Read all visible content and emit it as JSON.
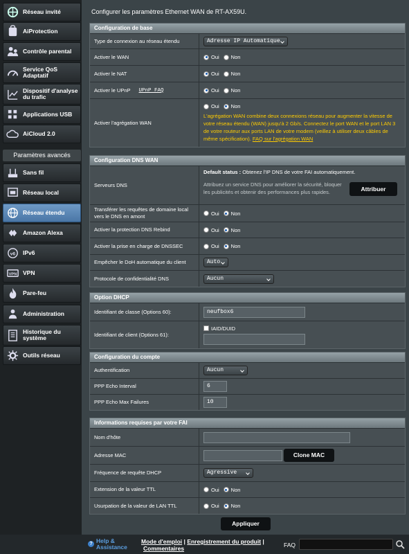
{
  "sidebar": {
    "top_items": [
      {
        "label": "Réseau invité",
        "icon": "guest-network-icon"
      },
      {
        "label": "AiProtection",
        "icon": "aiprotection-icon"
      },
      {
        "label": "Contrôle parental",
        "icon": "parental-control-icon"
      },
      {
        "label": "Service QoS Adaptatif",
        "icon": "qos-icon"
      },
      {
        "label": "Dispositif d'analyse du trafic",
        "icon": "traffic-analyzer-icon"
      },
      {
        "label": "Applications USB",
        "icon": "usb-icon"
      },
      {
        "label": "AiCloud 2.0",
        "icon": "cloud-icon"
      }
    ],
    "advanced_header": "Paramètres avancés",
    "adv_items": [
      {
        "label": "Sans fil",
        "icon": "wireless-icon"
      },
      {
        "label": "Réseau local",
        "icon": "lan-icon"
      },
      {
        "label": "Réseau étendu",
        "icon": "wan-icon"
      },
      {
        "label": "Amazon Alexa",
        "icon": "alexa-icon"
      },
      {
        "label": "IPv6",
        "icon": "ipv6-icon"
      },
      {
        "label": "VPN",
        "icon": "vpn-icon"
      },
      {
        "label": "Pare-feu",
        "icon": "firewall-icon"
      },
      {
        "label": "Administration",
        "icon": "admin-icon"
      },
      {
        "label": "Historique du système",
        "icon": "log-icon"
      },
      {
        "label": "Outils réseau",
        "icon": "tools-icon"
      }
    ]
  },
  "intro": "Configurer les paramètres Ethernet WAN de RT-AX59U.",
  "common": {
    "yes": "Oui",
    "no": "Non"
  },
  "basic": {
    "title": "Configuration de base",
    "conn_type_label": "Type de connexion au réseau étendu",
    "conn_type_value": "Adresse IP Automatique",
    "enable_wan": "Activer le WAN",
    "enable_nat": "Activer le NAT",
    "enable_upnp": "Activer le UPnP",
    "upnp_faq": "UPnP FAQ",
    "wan_agg": "Activer l'agrégation WAN",
    "wan_agg_desc": "L'agrégation WAN combine deux connexions réseau pour augmenter la vitesse de votre réseau étendu (WAN) jusqu'à 2 Gb/s. Connectez le port WAN et le port LAN 3 de votre routeur aux ports LAN de votre modem (veillez à utiliser deux câbles de même spécification).",
    "wan_agg_faq": "FAQ sur l'agrégation WAN"
  },
  "dns": {
    "title": "Configuration DNS WAN",
    "servers_label": "Serveurs DNS",
    "default_status": "Default status :",
    "default_status_text": "Obtenez l'IP DNS de votre FAI automatiquement.",
    "assign_desc": "Attribuez un service DNS pour améliorer la sécurité, bloquer les publicités et obtenir des performances plus rapides.",
    "assign_button": "Attribuer",
    "forward_label": "Transférer les requêtes de domaine local vers le DNS en amont",
    "rebind_label": "Activer la protection DNS Rebind",
    "dnssec_label": "Activer la prise en charge de DNSSEC",
    "doh_label": "Empêcher le DoH automatique du client",
    "doh_value": "Auto",
    "privacy_label": "Protocole de confidentialité DNS",
    "privacy_value": "Aucun"
  },
  "dhcp": {
    "title": "Option DHCP",
    "class_label": "Identifiant de classe (Options 60):",
    "class_value": "neufbox6",
    "client_label": "Identifiant de client (Options 61):",
    "iaid_label": "IAID/DUID",
    "client_value": ""
  },
  "account": {
    "title": "Configuration du compte",
    "auth_label": "Authentification",
    "auth_value": "Aucun",
    "echo_interval_label": "PPP Echo Interval",
    "echo_interval_value": "6",
    "echo_failures_label": "PPP Echo Max Failures",
    "echo_failures_value": "10"
  },
  "isp": {
    "title": "Informations requises par votre FAI",
    "host_label": "Nom d'hôte",
    "host_value": "",
    "mac_label": "Adresse MAC",
    "mac_value": "",
    "clone_mac": "Clone MAC",
    "dhcp_freq_label": "Fréquence de requête DHCP",
    "dhcp_freq_value": "Agressive",
    "ttl_label": "Extension de la valeur TTL",
    "lan_ttl_label": "Usurpation de la valeur de LAN TTL"
  },
  "apply": "Appliquer",
  "footer": {
    "help": "Help & Assistance",
    "manual": "Mode d'emploi",
    "sep": "|",
    "registration": "Enregistrement du produit",
    "comments": "Commentaires",
    "faq": "FAQ"
  },
  "colors": {
    "accent": "#ffcc00",
    "active_nav": "#5b88b8"
  }
}
